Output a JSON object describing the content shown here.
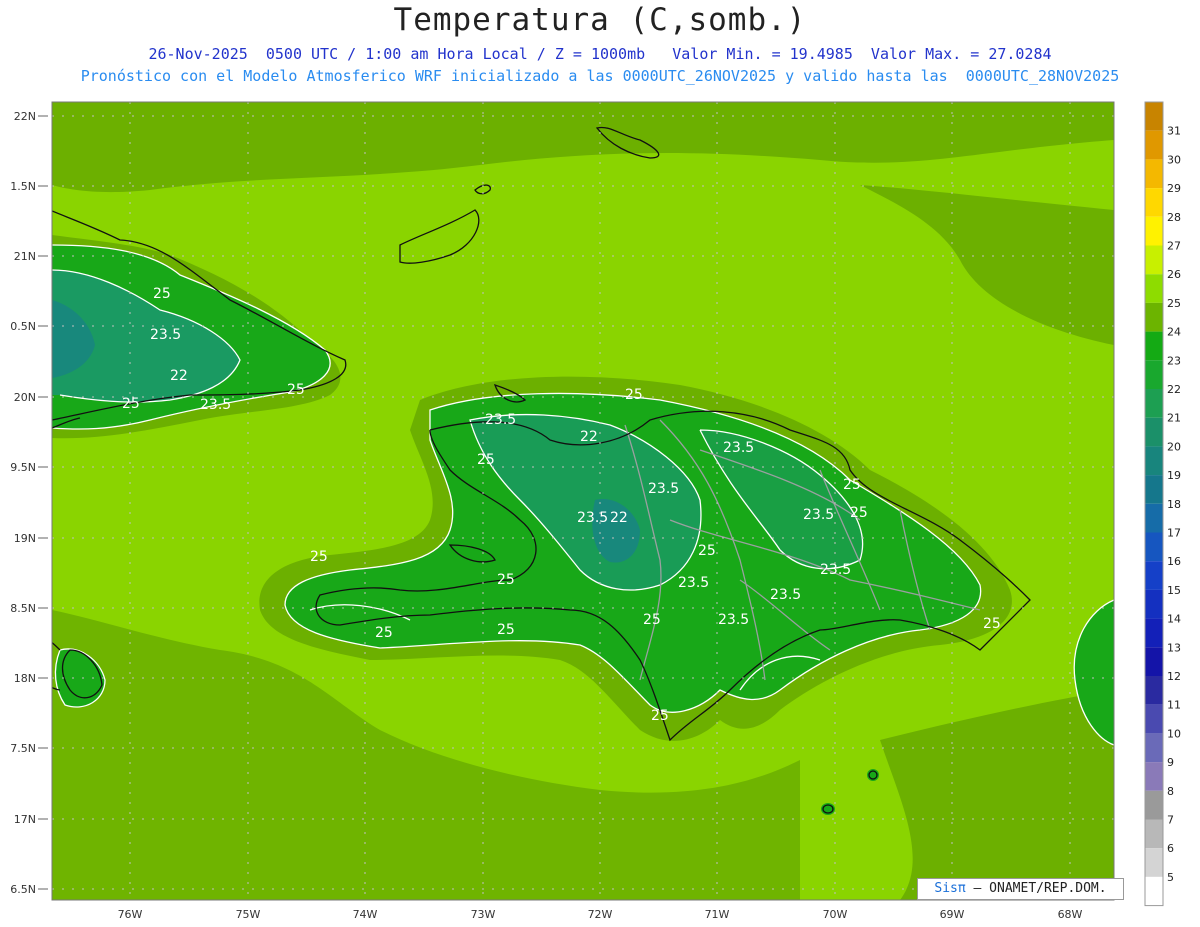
{
  "header": {
    "title": "Temperatura (C,somb.)",
    "line1": "26-Nov-2025  0500 UTC / 1:00 am Hora Local / Z = 1000mb   Valor Min. = 19.4985  Valor Max. = 27.0284",
    "line2": "Pronóstico con el Modelo Atmosferico WRF inicializado a las 0000UTC_26NOV2025 y valido hasta las  0000UTC_28NOV2025"
  },
  "axes": {
    "lat_labels": [
      "22N",
      "1.5N",
      "21N",
      "0.5N",
      "20N",
      "9.5N",
      "19N",
      "8.5N",
      "18N",
      "7.5N",
      "17N",
      "6.5N"
    ],
    "lon_labels": [
      "76W",
      "75W",
      "74W",
      "73W",
      "72W",
      "71W",
      "70W",
      "69W",
      "68W"
    ]
  },
  "colorbar": {
    "labels": [
      "31",
      "30",
      "29",
      "28",
      "27",
      "26",
      "25",
      "24",
      "23",
      "22",
      "21",
      "20",
      "19",
      "18",
      "17",
      "16",
      "15",
      "14",
      "13",
      "12",
      "11",
      "10",
      "9",
      "8",
      "7",
      "6",
      "5"
    ],
    "colors": [
      "#c88400",
      "#e09800",
      "#f4b800",
      "#ffd800",
      "#fff200",
      "#c8f000",
      "#8edc00",
      "#6cb400",
      "#14aa14",
      "#19a82e",
      "#1d9f52",
      "#1b9069",
      "#18857d",
      "#15778c",
      "#166ca8",
      "#1656c0",
      "#1540c8",
      "#1430c0",
      "#1320b8",
      "#1414a8",
      "#2a2aa0",
      "#4a4ab0",
      "#6a6ab8",
      "#8a7ab8",
      "#9a9a9a",
      "#b8b8b8",
      "#d4d4d4"
    ]
  },
  "contour_labels": [
    "25",
    "23.5",
    "22",
    "25",
    "23.5",
    "25",
    "25",
    "23.5",
    "22",
    "25",
    "23.5",
    "23.5",
    "25",
    "23.5",
    "23.5",
    "22",
    "25",
    "25",
    "25",
    "25",
    "23.5",
    "23.5",
    "23.5",
    "23.5",
    "25",
    "25",
    "25",
    "25",
    "25"
  ],
  "credit": {
    "brand": "Sisπ",
    "text": " – ONAMET/REP.DOM."
  },
  "colors": {
    "ocean": "#8ad400",
    "land_outer": "#6cb000",
    "land_mid": "#18a818",
    "land_cool": "#1a9a62",
    "land_cold": "#18887c"
  }
}
